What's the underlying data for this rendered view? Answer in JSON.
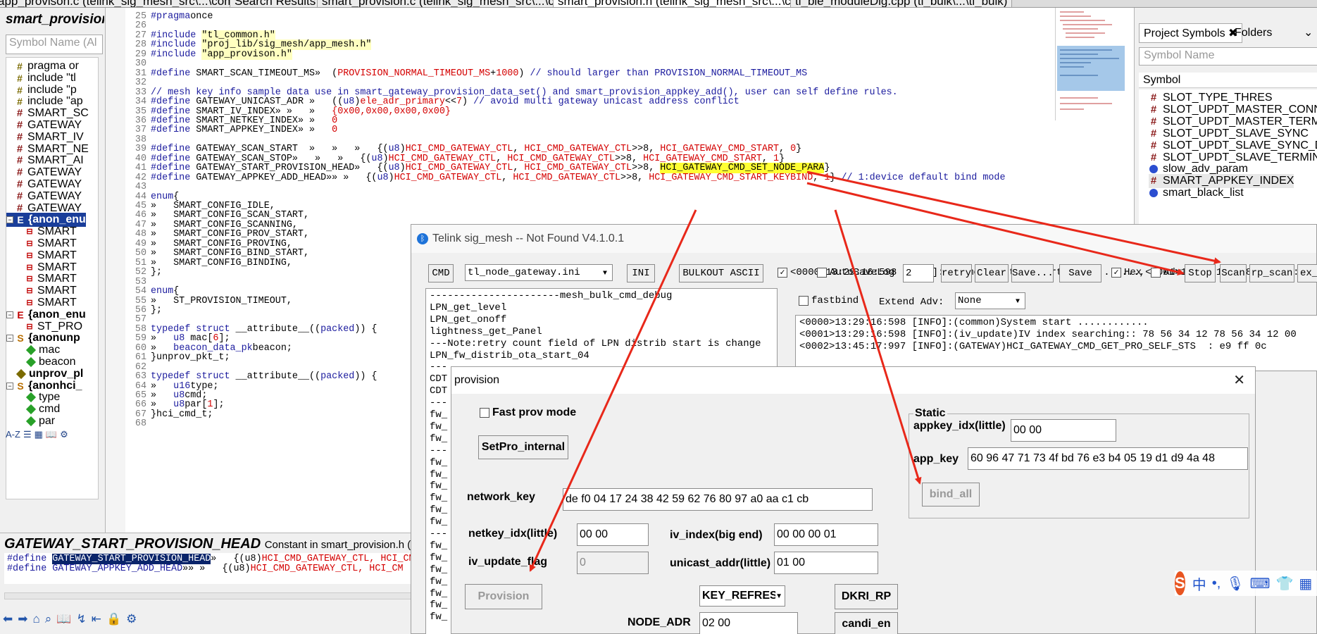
{
  "tabs": [
    "app_provison.c (telink_sig_mesh_src\\...\\common)",
    "Search Results",
    "smart_provision.c (telink_sig_mesh_src\\...\\common)",
    "smart_provision.h (telink_sig_mesh_src\\...\\common)",
    "tl_ble_moduleDlg.cpp (tl_bulk\\...\\tl_bulk)"
  ],
  "left": {
    "title": "smart_provision",
    "search_placeholder": "Symbol Name (Al",
    "items": [
      {
        "label": "pragma or",
        "kind": "inc"
      },
      {
        "label": "include \"tl",
        "kind": "inc"
      },
      {
        "label": "include \"p",
        "kind": "inc"
      },
      {
        "label": "include \"ap",
        "kind": "inc"
      },
      {
        "label": "SMART_SC",
        "kind": "hash"
      },
      {
        "label": "GATEWAY",
        "kind": "hash"
      },
      {
        "label": "SMART_IV",
        "kind": "hash"
      },
      {
        "label": "SMART_NE",
        "kind": "hash"
      },
      {
        "label": "SMART_AI",
        "kind": "hash"
      },
      {
        "label": "GATEWAY",
        "kind": "hash"
      },
      {
        "label": "GATEWAY",
        "kind": "hash"
      },
      {
        "label": "GATEWAY",
        "kind": "hash"
      },
      {
        "label": "GATEWAY",
        "kind": "hash"
      },
      {
        "label": "{anon_enu",
        "kind": "enm"
      },
      {
        "label": "SMART",
        "kind": "mem"
      },
      {
        "label": "SMART",
        "kind": "mem"
      },
      {
        "label": "SMART",
        "kind": "mem"
      },
      {
        "label": "SMART",
        "kind": "mem"
      },
      {
        "label": "SMART",
        "kind": "mem"
      },
      {
        "label": "SMART",
        "kind": "mem"
      },
      {
        "label": "SMART",
        "kind": "mem"
      },
      {
        "label": "{anon_enu",
        "kind": "enm"
      },
      {
        "label": "ST_PRO",
        "kind": "mem"
      },
      {
        "label": "{anonunp",
        "kind": "str"
      },
      {
        "label": "mac",
        "kind": "fld"
      },
      {
        "label": "beacon",
        "kind": "fld"
      },
      {
        "label": "unprov_pl",
        "kind": "fld2"
      },
      {
        "label": "{anonhci_",
        "kind": "str"
      },
      {
        "label": "type",
        "kind": "fld"
      },
      {
        "label": "cmd",
        "kind": "fld"
      },
      {
        "label": "par",
        "kind": "fld"
      }
    ]
  },
  "code": [
    {
      "n": "25",
      "t": [
        [
          "kw",
          "#pragma"
        ],
        [
          "",
          "once"
        ]
      ]
    },
    {
      "n": "26",
      "t": []
    },
    {
      "n": "27",
      "t": [
        [
          "kw",
          "#include "
        ],
        [
          "st",
          "\"tl_common.h\""
        ]
      ]
    },
    {
      "n": "28",
      "t": [
        [
          "kw",
          "#include "
        ],
        [
          "st",
          "\"proj_lib/sig_mesh/app_mesh.h\""
        ]
      ]
    },
    {
      "n": "29",
      "t": [
        [
          "kw",
          "#include "
        ],
        [
          "st",
          "\"app_provison.h\""
        ]
      ]
    },
    {
      "n": "30",
      "t": []
    },
    {
      "n": "31",
      "t": [
        [
          "kw",
          "#define "
        ],
        [
          "",
          "SMART_SCAN_TIMEOUT_MS»  ("
        ],
        [
          "rd",
          "PROVISION_NORMAL_TIMEOUT_MS"
        ],
        [
          "",
          "+"
        ],
        [
          "rd",
          "1000"
        ],
        [
          "",
          ") "
        ],
        [
          "cm",
          "// should larger than PROVISION_NORMAL_TIMEOUT_MS"
        ]
      ]
    },
    {
      "n": "32",
      "t": []
    },
    {
      "n": "33",
      "t": [
        [
          "cm",
          "// mesh key info sample data use in smart_gateway_provision_data_set() and smart_provision_appkey_add(), user can self define rules."
        ]
      ]
    },
    {
      "n": "34",
      "t": [
        [
          "kw",
          "#define "
        ],
        [
          "",
          "GATEWAY_UNICAST_ADR »   (("
        ],
        [
          "kw",
          "u8"
        ],
        [
          "",
          ")"
        ],
        [
          "rd",
          "ele_adr_primary"
        ],
        [
          "",
          "<<"
        ],
        [
          "rd",
          "7"
        ],
        [
          "",
          ") "
        ],
        [
          "cm",
          "// avoid multi gateway unicast address conflict"
        ]
      ]
    },
    {
      "n": "35",
      "t": [
        [
          "kw",
          "#define "
        ],
        [
          "",
          "SMART_IV_INDEX» »   »   "
        ],
        [
          "rd",
          "{0x00,0x00,0x00,0x00}"
        ]
      ]
    },
    {
      "n": "36",
      "t": [
        [
          "kw",
          "#define "
        ],
        [
          "",
          "SMART_NETKEY_INDEX» »   "
        ],
        [
          "rd",
          "0"
        ]
      ]
    },
    {
      "n": "37",
      "t": [
        [
          "kw",
          "#define "
        ],
        [
          "",
          "SMART_APPKEY_INDEX» »   "
        ],
        [
          "rd",
          "0"
        ]
      ]
    },
    {
      "n": "38",
      "t": []
    },
    {
      "n": "39",
      "t": [
        [
          "kw",
          "#define "
        ],
        [
          "",
          "GATEWAY_SCAN_START  »   »   »   {("
        ],
        [
          "kw",
          "u8"
        ],
        [
          "",
          ")"
        ],
        [
          "rd",
          "HCI_CMD_GATEWAY_CTL"
        ],
        [
          "",
          ", "
        ],
        [
          "rd",
          "HCI_CMD_GATEWAY_CTL"
        ],
        [
          "",
          ">>8, "
        ],
        [
          "rd",
          "HCI_GATEWAY_CMD_START"
        ],
        [
          "",
          ", "
        ],
        [
          "rd",
          "0"
        ],
        [
          "",
          "}"
        ]
      ]
    },
    {
      "n": "40",
      "t": [
        [
          "kw",
          "#define "
        ],
        [
          "",
          "GATEWAY_SCAN_STOP»   »   »   {("
        ],
        [
          "kw",
          "u8"
        ],
        [
          "",
          ")"
        ],
        [
          "rd",
          "HCI_CMD_GATEWAY_CTL"
        ],
        [
          "",
          ", "
        ],
        [
          "rd",
          "HCI_CMD_GATEWAY_CTL"
        ],
        [
          "",
          ">>8, "
        ],
        [
          "rd",
          "HCI_GATEWAY_CMD_START"
        ],
        [
          "",
          ", "
        ],
        [
          "rd",
          "1"
        ],
        [
          "",
          "}"
        ]
      ]
    },
    {
      "n": "41",
      "t": [
        [
          "kw",
          "#define "
        ],
        [
          "",
          "GATEWAY_START_PROVISION_HEAD»   {("
        ],
        [
          "kw",
          "u8"
        ],
        [
          "",
          ")"
        ],
        [
          "rd",
          "HCI_CMD_GATEWAY_CTL"
        ],
        [
          "",
          ", "
        ],
        [
          "rd",
          "HCI_CMD_GATEWAY_CTL"
        ],
        [
          "",
          ">>8, "
        ],
        [
          "hly",
          "HCI_GATEWAY_CMD_SET_NODE_PARA"
        ],
        [
          "",
          "}"
        ]
      ]
    },
    {
      "n": "42",
      "t": [
        [
          "kw",
          "#define "
        ],
        [
          "",
          "GATEWAY_APPKEY_ADD_HEAD»» »   {("
        ],
        [
          "kw",
          "u8"
        ],
        [
          "",
          ")"
        ],
        [
          "rd",
          "HCI_CMD_GATEWAY_CTL"
        ],
        [
          "",
          ", "
        ],
        [
          "rd",
          "HCI_CMD_GATEWAY_CTL"
        ],
        [
          "",
          ">>8, "
        ],
        [
          "rd",
          "HCI_GATEWAY_CMD_START_KEYBIND"
        ],
        [
          "",
          ", "
        ],
        [
          "rd",
          "1"
        ],
        [
          "",
          "} "
        ],
        [
          "cm",
          "// 1:device default bind mode"
        ]
      ]
    },
    {
      "n": "43",
      "t": []
    },
    {
      "n": "44",
      "t": [
        [
          "kw",
          "enum"
        ],
        [
          "",
          "{"
        ]
      ]
    },
    {
      "n": "45",
      "t": [
        [
          "",
          "»   SMART_CONFIG_IDLE,"
        ]
      ]
    },
    {
      "n": "46",
      "t": [
        [
          "",
          "»   SMART_CONFIG_SCAN_START,"
        ]
      ]
    },
    {
      "n": "47",
      "t": [
        [
          "",
          "»   SMART_CONFIG_SCANNING,"
        ]
      ]
    },
    {
      "n": "48",
      "t": [
        [
          "",
          "»   SMART_CONFIG_PROV_START,"
        ]
      ]
    },
    {
      "n": "49",
      "t": [
        [
          "",
          "»   SMART_CONFIG_PROVING,"
        ]
      ]
    },
    {
      "n": "50",
      "t": [
        [
          "",
          "»   SMART_CONFIG_BIND_START,"
        ]
      ]
    },
    {
      "n": "51",
      "t": [
        [
          "",
          "»   SMART_CONFIG_BINDING,"
        ]
      ]
    },
    {
      "n": "52",
      "t": [
        [
          "",
          "};"
        ]
      ]
    },
    {
      "n": "53",
      "t": []
    },
    {
      "n": "54",
      "t": [
        [
          "kw",
          "enum"
        ],
        [
          "",
          "{"
        ]
      ]
    },
    {
      "n": "55",
      "t": [
        [
          "",
          "»   ST_PROVISION_TIMEOUT,"
        ]
      ]
    },
    {
      "n": "56",
      "t": [
        [
          "",
          "};"
        ]
      ]
    },
    {
      "n": "57",
      "t": []
    },
    {
      "n": "58",
      "t": [
        [
          "kw",
          "typedef struct "
        ],
        [
          "",
          "__attribute__(("
        ],
        [
          "kw",
          "packed"
        ],
        [
          "",
          ")) {"
        ]
      ]
    },
    {
      "n": "59",
      "t": [
        [
          "",
          "»   "
        ],
        [
          "kw",
          "u8"
        ],
        [
          "",
          " mac["
        ],
        [
          "rd",
          "6"
        ],
        [
          "",
          "];"
        ]
      ]
    },
    {
      "n": "60",
      "t": [
        [
          "",
          "»   "
        ],
        [
          "kw",
          "beacon_data_pk"
        ],
        [
          "",
          ""
        ],
        [
          "",
          "beacon;"
        ]
      ]
    },
    {
      "n": "61",
      "t": [
        [
          "",
          "}unprov_pkt_t;"
        ]
      ]
    },
    {
      "n": "62",
      "t": []
    },
    {
      "n": "63",
      "t": [
        [
          "kw",
          "typedef struct "
        ],
        [
          "",
          "__attribute__(("
        ],
        [
          "kw",
          "packed"
        ],
        [
          "",
          ")) {"
        ]
      ]
    },
    {
      "n": "64",
      "t": [
        [
          "",
          "»   "
        ],
        [
          "kw",
          "u16"
        ],
        [
          "",
          ""
        ],
        [
          "",
          "type;"
        ]
      ]
    },
    {
      "n": "65",
      "t": [
        [
          "",
          "»   "
        ],
        [
          "kw",
          "u8"
        ],
        [
          "",
          ""
        ],
        [
          "",
          "cmd;"
        ]
      ]
    },
    {
      "n": "66",
      "t": [
        [
          "",
          "»   "
        ],
        [
          "kw",
          "u8"
        ],
        [
          "",
          ""
        ],
        [
          "",
          "par["
        ],
        [
          "rd",
          "1"
        ],
        [
          "",
          "];"
        ]
      ]
    },
    {
      "n": "67",
      "t": [
        [
          "",
          "}hci_cmd_t;"
        ]
      ]
    },
    {
      "n": "68",
      "t": []
    }
  ],
  "right": {
    "tab_symbols": "Project Symbols",
    "tab_folders": "Folders",
    "search_placeholder": "Symbol Name",
    "header": "Symbol",
    "items": [
      {
        "label": "SLOT_TYPE_THRES",
        "kind": "hash"
      },
      {
        "label": "SLOT_UPDT_MASTER_CONN",
        "kind": "hash"
      },
      {
        "label": "SLOT_UPDT_MASTER_TERMIN",
        "kind": "hash"
      },
      {
        "label": "SLOT_UPDT_SLAVE_SYNC",
        "kind": "hash"
      },
      {
        "label": "SLOT_UPDT_SLAVE_SYNC_DON",
        "kind": "hash"
      },
      {
        "label": "SLOT_UPDT_SLAVE_TERMINA",
        "kind": "hash"
      },
      {
        "label": "slow_adv_param",
        "kind": "ball"
      },
      {
        "label": "SMART_APPKEY_INDEX",
        "kind": "hash"
      },
      {
        "label": "smart_black_list",
        "kind": "ball"
      }
    ]
  },
  "context": {
    "title": "GATEWAY_START_PROVISION_HEAD",
    "subtitle": "Constant in smart_provision.h (telin",
    "line1_a": "#define ",
    "line1_sel": "GATEWAY_START_PROVISION_HEAD",
    "line1_b": "»   {(u8)",
    "line1_c": "HCI_CMD_GATEWAY_CTL, HCI_CM",
    "line2_a": "#define ",
    "line2_sel": "GATEWAY_APPKEY_ADD_HEAD",
    "line2_b": "»» »   {(u8)",
    "line2_c": "HCI_CMD_GATEWAY_CTL, HCI_CM"
  },
  "app": {
    "title": "Telink sig_mesh -- Not Found    V4.1.0.1",
    "cmd": "CMD",
    "ini_file": "tl_node_gateway.ini",
    "ini": "INI",
    "bulkout": "BULKOUT ASCII",
    "log": [
      "<0000>13:29:16:598 [INFO]:(common)System start ............",
      "<0001>13:29:16:598 [INFO]:(iv_update)IV index searching:: 78 56 34 12 78 56 34 12 00",
      "<0002>13:45:17:997 [INFO]:(GATEWAY)HCI_GATEWAY_CMD_GET_PRO_SELF_STS  : e9 ff 0c"
    ],
    "autosave": "AutoSaveLog",
    "retry_val": "2",
    "retry": "retry",
    "clear": "Clear",
    "save_dots": "Save...",
    "save": "Save",
    "hex": "Hex",
    "adv": "Adv",
    "stop": "Stop",
    "scan": "Scan",
    "rp_scan": "rp_scan",
    "ex": "ex_",
    "fastbind": "fastbind",
    "extend_adv": "Extend Adv:",
    "extend_val": "None",
    "list": [
      "----------------------mesh_bulk_cmd_debug",
      "LPN_get_level",
      "LPN_get_onoff",
      "lightness_get_Panel",
      "---Note:retry count field of LPN distrib start is change",
      "LPN_fw_distrib_ota_start_04",
      "---",
      "CDT",
      "CDT",
      "---",
      "fw_",
      "fw_",
      "fw_",
      "---",
      "fw_",
      "fw_",
      "fw_",
      "fw_",
      "fw_",
      "fw_",
      "---",
      "fw_",
      "fw_",
      "fw_",
      "fw_",
      "fw_",
      "fw_",
      "fw_"
    ]
  },
  "dialog": {
    "title": "provision",
    "fast_prov": "Fast prov mode",
    "setpro": "SetPro_internal",
    "static": "Static",
    "appkey_idx_label": "appkey_idx(little)",
    "appkey_idx": "00 00",
    "app_key_label": "app_key",
    "app_key": "60 96 47 71 73 4f bd 76 e3 b4 05 19 d1 d9 4a 48",
    "bind_all": "bind_all",
    "network_key_label": "network_key",
    "network_key": "de f0 04 17 24 38 42 59 62 76 80 97 a0 aa c1 cb",
    "netkey_idx_label": "netkey_idx(little)",
    "netkey_idx": "00 00",
    "iv_index_label": "iv_index(big end)",
    "iv_index": "00 00 00 01",
    "iv_update_label": "iv_update_flag",
    "iv_update": "0",
    "unicast_label": "unicast_addr(little)",
    "unicast": "01 00",
    "provision": "Provision",
    "key_refresh": "KEY_REFRESH",
    "dkri": "DKRI_RP",
    "node_adr_label": "NODE_ADR",
    "node_adr": "02 00",
    "candi": "candi_en"
  },
  "ime": {
    "lang": "中",
    "punct": "•,"
  },
  "colors": {
    "accent": "#1a3e9a",
    "arrow": "#e8281a",
    "string_bg": "#ffffc0",
    "highlight": "#ffff33",
    "macro_red": "#d40000",
    "keyword_blue": "#1b1b9e"
  }
}
